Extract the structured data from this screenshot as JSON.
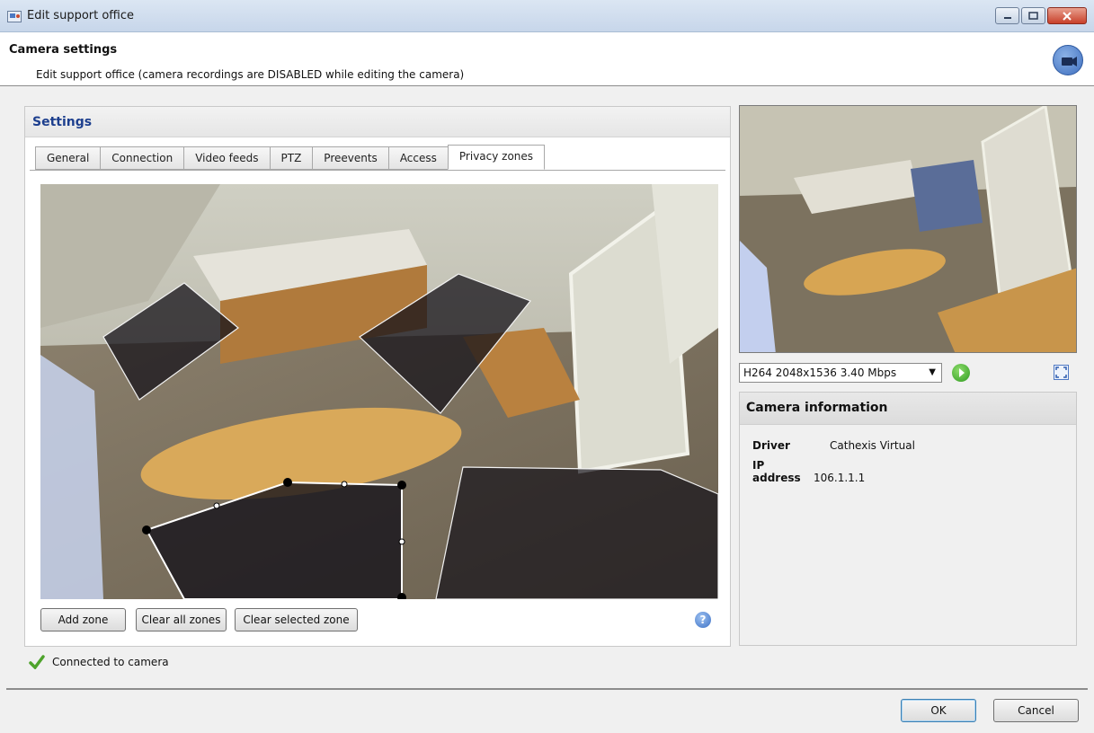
{
  "window": {
    "title": "Edit support office",
    "app_icon": "camera-settings-icon"
  },
  "header": {
    "title": "Camera settings",
    "subtitle": "Edit support office (camera recordings are DISABLED while editing the camera)",
    "badge_icon": "camera-icon"
  },
  "settings": {
    "title": "Settings",
    "tabs": [
      {
        "label": "General",
        "active": false
      },
      {
        "label": "Connection",
        "active": false
      },
      {
        "label": "Video feeds",
        "active": false
      },
      {
        "label": "PTZ",
        "active": false
      },
      {
        "label": "Preevents",
        "active": false
      },
      {
        "label": "Access",
        "active": false
      },
      {
        "label": "Privacy zones",
        "active": true
      }
    ],
    "buttons": {
      "add_zone": "Add zone",
      "clear_all": "Clear all zones",
      "clear_selected": "Clear selected zone"
    },
    "help_icon": "help-icon"
  },
  "stream": {
    "selected": "H264 2048x1536 3.40 Mbps"
  },
  "camera_info": {
    "title": "Camera information",
    "rows": [
      {
        "label": "Driver",
        "value": "Cathexis Virtual"
      },
      {
        "label": "IP address",
        "value": "106.1.1.1"
      }
    ]
  },
  "status": {
    "text": "Connected to camera",
    "icon": "check-icon"
  },
  "footer": {
    "ok": "OK",
    "cancel": "Cancel"
  }
}
